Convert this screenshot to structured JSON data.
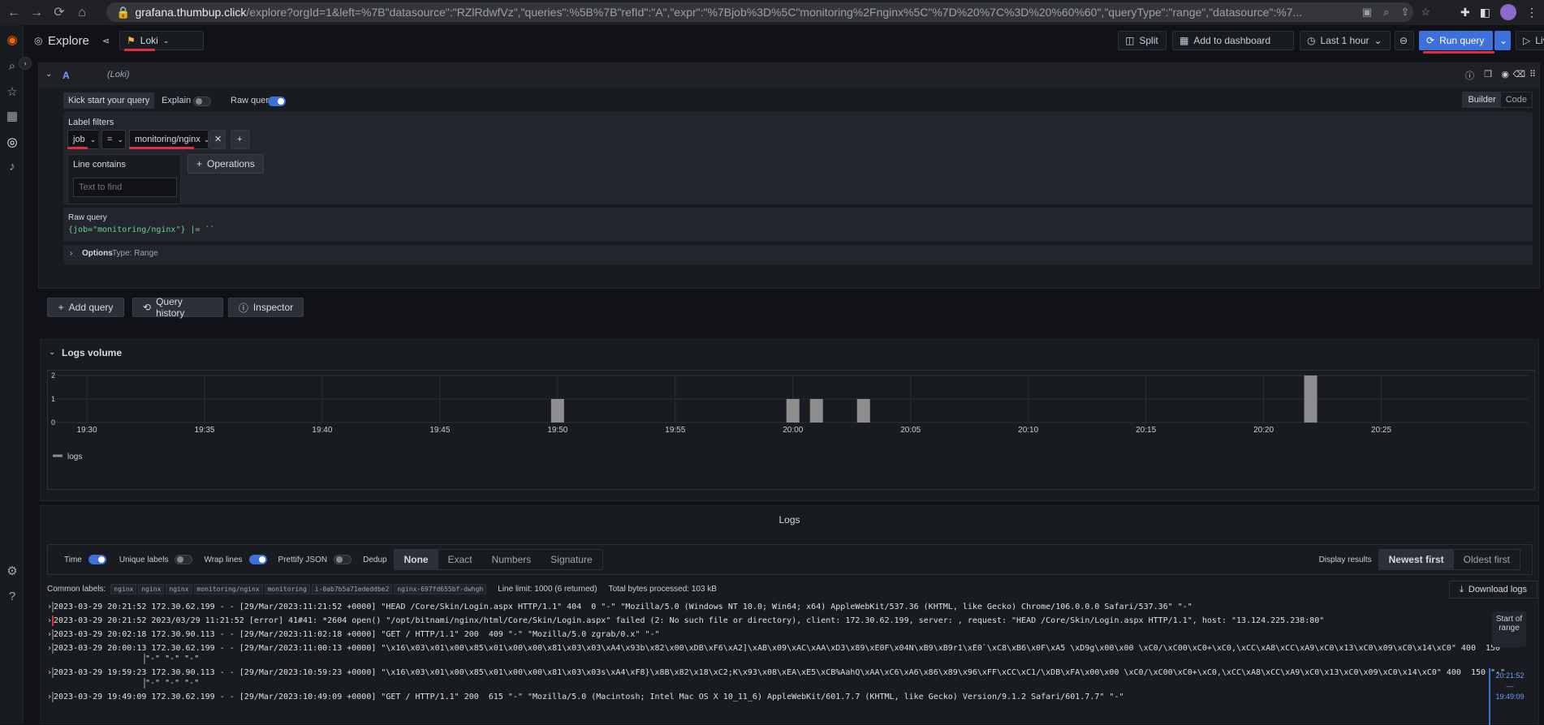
{
  "browser": {
    "url_host": "grafana.thumbup.click",
    "url_path": "/explore?orgId=1&left=%7B\"datasource\":\"RZlRdwfVz\",\"queries\":%5B%7B\"refId\":\"A\",\"expr\":\"%7Bjob%3D%5C\"monitoring%2Fnginx%5C\"%7D%20%7C%3D%20%60%60\",\"queryType\":\"range\",\"datasource\":%7..."
  },
  "header": {
    "title": "Explore",
    "datasource": "Loki",
    "split": "Split",
    "add_to_dashboard": "Add to dashboard",
    "time_range": "Last 1 hour",
    "run_query": "Run query",
    "live": "Live"
  },
  "query": {
    "ref_id": "A",
    "ds_label": "(Loki)",
    "kick_start": "Kick start your query",
    "explain": "Explain",
    "raw_query_toggle": "Raw query",
    "builder": "Builder",
    "code": "Code",
    "label_filters": "Label filters",
    "label": "job",
    "operator": "=",
    "value": "monitoring/nginx",
    "line_contains": "Line contains",
    "text_placeholder": "Text to find",
    "operations": "Operations",
    "raw_query_label": "Raw query",
    "raw_query_text": "{job=\"monitoring/nginx\"} |= ``",
    "options": "Options",
    "options_type": "Type: Range"
  },
  "actions": {
    "add_query": "Add query",
    "query_history": "Query history",
    "inspector": "Inspector"
  },
  "logs_volume": {
    "title": "Logs volume",
    "legend": "logs"
  },
  "chart_data": {
    "type": "bar",
    "title": "Logs volume",
    "x_tick_labels": [
      "19:30",
      "19:35",
      "19:40",
      "19:45",
      "19:50",
      "19:55",
      "20:00",
      "20:05",
      "20:10",
      "20:15",
      "20:20",
      "20:25"
    ],
    "y_tick_labels": [
      "0",
      "1",
      "2"
    ],
    "ylim": [
      0,
      2
    ],
    "series": [
      {
        "name": "logs",
        "x_minutes_after_1930": [
          20,
          30,
          31,
          33,
          52
        ],
        "values": [
          1,
          1,
          1,
          1,
          2
        ]
      }
    ],
    "legend_position": "bottom-left",
    "grid": true,
    "color": "#8e8e8e"
  },
  "logs": {
    "title": "Logs",
    "time": "Time",
    "unique_labels": "Unique labels",
    "wrap_lines": "Wrap lines",
    "prettify_json": "Prettify JSON",
    "dedup": "Dedup",
    "dedup_options": [
      "None",
      "Exact",
      "Numbers",
      "Signature"
    ],
    "display_results": "Display results",
    "newest_first": "Newest first",
    "oldest_first": "Oldest first",
    "common_labels_label": "Common labels:",
    "common_labels": [
      "nginx",
      "nginx",
      "nginx",
      "monitoring/nginx",
      "monitoring",
      "i-0ab7b5a71ededdbe2",
      "nginx-697fd655bf-dwhgh"
    ],
    "line_limit": "Line limit: 1000 (6 returned)",
    "bytes": "Total bytes processed: 103 kB",
    "download": "Download logs",
    "start_of_range": "Start of range",
    "range_top": "20:21:52",
    "range_dash": "—",
    "range_bottom": "19:49:09",
    "lines": [
      "2023-03-29 20:21:52 172.30.62.199 - - [29/Mar/2023:11:21:52 +0000] \"HEAD /Core/Skin/Login.aspx HTTP/1.1\" 404  0 \"-\" \"Mozilla/5.0 (Windows NT 10.0; Win64; x64) AppleWebKit/537.36 (KHTML, like Gecko) Chrome/106.0.0.0 Safari/537.36\" \"-\"",
      "2023-03-29 20:21:52 2023/03/29 11:21:52 [error] 41#41: *2604 open() \"/opt/bitnami/nginx/html/Core/Skin/Login.aspx\" failed (2: No such file or directory), client: 172.30.62.199, server: , request: \"HEAD /Core/Skin/Login.aspx HTTP/1.1\", host: \"13.124.225.238:80\"",
      "2023-03-29 20:02:18 172.30.90.113 - - [29/Mar/2023:11:02:18 +0000] \"GET / HTTP/1.1\" 200  409 \"-\" \"Mozilla/5.0 zgrab/0.x\" \"-\"",
      "2023-03-29 20:00:13 172.30.62.199 - - [29/Mar/2023:11:00:13 +0000] \"\\x16\\x03\\x01\\x00\\x85\\x01\\x00\\x00\\x81\\x03\\x03\\xA4\\x93b\\x82\\x00\\xDB\\xF6\\xA2]\\xAB\\x09\\xAC\\xAA\\xD3\\x89\\xE0F\\x04N\\xB9\\xB9r1\\xE0`\\xC8\\xB6\\x0F\\xA5 \\xD9g\\x00\\x00 \\xC0/\\xC00\\xC0+\\xC0,\\xCC\\xA8\\xCC\\xA9\\xC0\\x13\\xC0\\x09\\xC0\\x14\\xC0\" 400  150",
      "\"-\" \"-\" \"-\"",
      "2023-03-29 19:59:23 172.30.90.113 - - [29/Mar/2023:10:59:23 +0000] \"\\x16\\x03\\x01\\x00\\x85\\x01\\x00\\x00\\x81\\x03\\x03s\\xA4\\xF8}\\x8B\\x82\\x18\\xC2;K\\x93\\x08\\xEA\\xE5\\xCB%AahQ\\xAA\\xC6\\xA6\\x86\\x89\\x96\\xFF\\xCC\\xC1/\\xDB\\xFA\\x00\\x00 \\xC0/\\xC00\\xC0+\\xC0,\\xCC\\xA8\\xCC\\xA9\\xC0\\x13\\xC0\\x09\\xC0\\x14\\xC0\" 400  150 \"-\"",
      "\"-\" \"-\" \"-\"",
      "2023-03-29 19:49:09 172.30.62.199 - - [29/Mar/2023:10:49:09 +0000] \"GET / HTTP/1.1\" 200  615 \"-\" \"Mozilla/5.0 (Macintosh; Intel Mac OS X 10_11_6) AppleWebKit/601.7.7 (KHTML, like Gecko) Version/9.1.2 Safari/601.7.7\" \"-\""
    ]
  }
}
